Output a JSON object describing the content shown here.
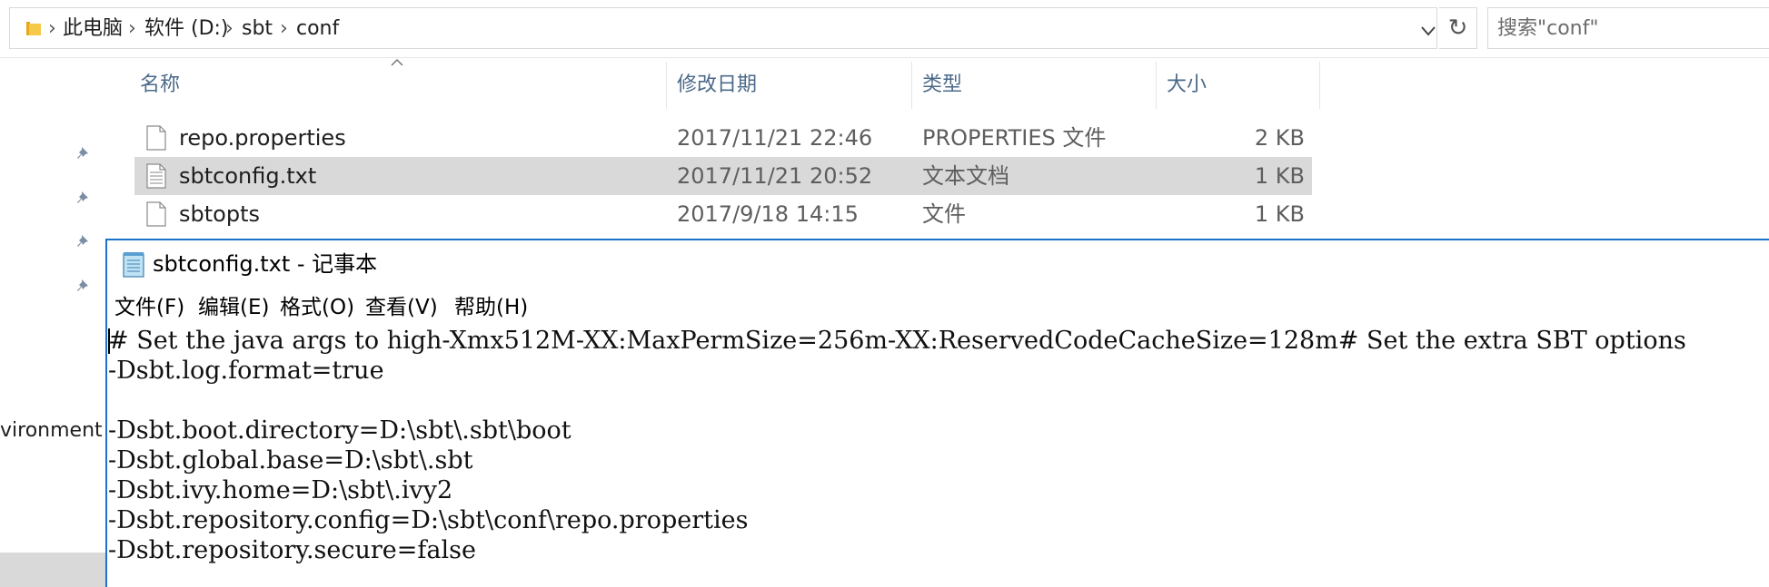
{
  "address_bar": {
    "crumbs": [
      "此电脑",
      "软件 (D:)",
      "sbt",
      "conf"
    ],
    "search_placeholder": "搜索\"conf\""
  },
  "nav_pane": {
    "visible_text": "vironment"
  },
  "columns": [
    "名称",
    "修改日期",
    "类型",
    "大小"
  ],
  "files": [
    {
      "name": "repo.properties",
      "date": "2017/11/21 22:46",
      "type": "PROPERTIES 文件",
      "size": "2 KB",
      "icon": "blank-file-icon",
      "selected": false
    },
    {
      "name": "sbtconfig.txt",
      "date": "2017/11/21 20:52",
      "type": "文本文档",
      "size": "1 KB",
      "icon": "text-file-icon",
      "selected": true
    },
    {
      "name": "sbtopts",
      "date": "2017/9/18 14:15",
      "type": "文件",
      "size": "1 KB",
      "icon": "blank-file-icon",
      "selected": false
    }
  ],
  "notepad": {
    "title": "sbtconfig.txt - 记事本",
    "menu": [
      "文件(F)",
      "编辑(E)",
      "格式(O)",
      "查看(V)",
      "帮助(H)"
    ],
    "lines": [
      "# Set the java args to high-Xmx512M-XX:MaxPermSize=256m-XX:ReservedCodeCacheSize=128m# Set the extra SBT options",
      "-Dsbt.log.format=true",
      "",
      "-Dsbt.boot.directory=D:\\sbt\\.sbt\\boot",
      "-Dsbt.global.base=D:\\sbt\\.sbt",
      "-Dsbt.ivy.home=D:\\sbt\\.ivy2",
      "-Dsbt.repository.config=D:\\sbt\\conf\\repo.properties",
      "-Dsbt.repository.secure=false"
    ]
  },
  "colors": {
    "accent_border": "#1a73c9",
    "selection": "#d9d9d9",
    "header_text": "#4b6a8a"
  }
}
